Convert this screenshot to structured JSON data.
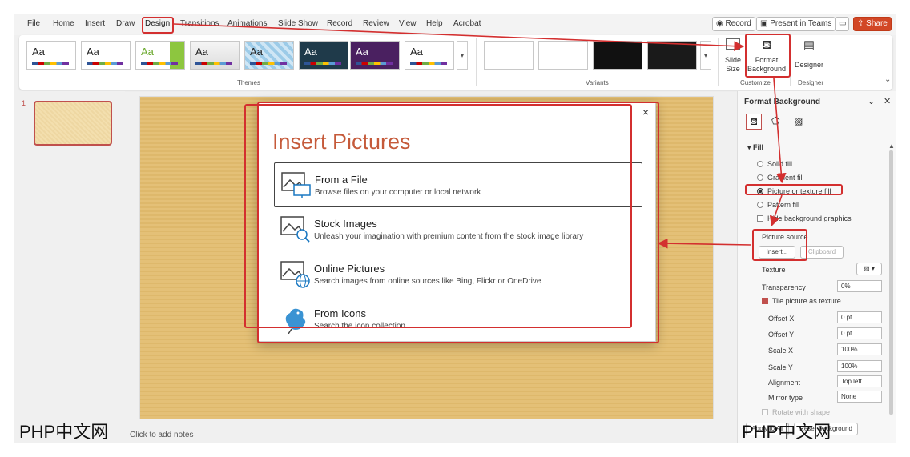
{
  "menu": {
    "tabs": [
      "File",
      "Home",
      "Insert",
      "Draw",
      "Design",
      "Transitions",
      "Animations",
      "Slide Show",
      "Record",
      "Review",
      "View",
      "Help",
      "Acrobat"
    ],
    "record_btn": "Record",
    "present_btn": "Present in Teams",
    "share_btn": "Share"
  },
  "ribbon": {
    "theme_label": "Aa",
    "themes_group": "Themes",
    "variants_group": "Variants",
    "slide_size": "Slide Size",
    "format_background": "Format Background",
    "designer": "Designer",
    "customize_group": "Customize",
    "designer_group": "Designer"
  },
  "thumbnails": {
    "slide_number": "1"
  },
  "notes": {
    "placeholder": "Click to add notes"
  },
  "dialog": {
    "title": "Insert Pictures",
    "close": "×",
    "options": [
      {
        "title": "From a File",
        "desc": "Browse files on your computer or local network"
      },
      {
        "title": "Stock Images",
        "desc": "Unleash your imagination with premium content from the stock image library"
      },
      {
        "title": "Online Pictures",
        "desc": "Search images from online sources like Bing, Flickr or OneDrive"
      },
      {
        "title": "From Icons",
        "desc": "Search the icon collection"
      }
    ]
  },
  "format_pane": {
    "title": "Format Background",
    "fill_header": "Fill",
    "solid_fill": "Solid fill",
    "gradient_fill": "Gradient fill",
    "picture_fill": "Picture or texture fill",
    "pattern_fill": "Pattern fill",
    "hide_bg": "Hide background graphics",
    "picture_source": "Picture source",
    "insert_btn": "Insert...",
    "clipboard_btn": "Clipboard",
    "texture": "Texture",
    "transparency": "Transparency",
    "transparency_val": "0%",
    "tile": "Tile picture as texture",
    "offset_x": "Offset X",
    "offset_x_val": "0 pt",
    "offset_y": "Offset Y",
    "offset_y_val": "0 pt",
    "scale_x": "Scale X",
    "scale_x_val": "100%",
    "scale_y": "Scale Y",
    "scale_y_val": "100%",
    "alignment": "Alignment",
    "alignment_val": "Top left",
    "mirror": "Mirror type",
    "mirror_val": "None",
    "rotate": "Rotate with shape",
    "apply_all": "Apply to All",
    "reset": "Reset Background"
  },
  "watermarks": [
    "PHP中文网",
    "PHP中文网"
  ],
  "colors": {
    "accent_red": "#d32f2f",
    "dialog_title": "#c55a3a"
  }
}
